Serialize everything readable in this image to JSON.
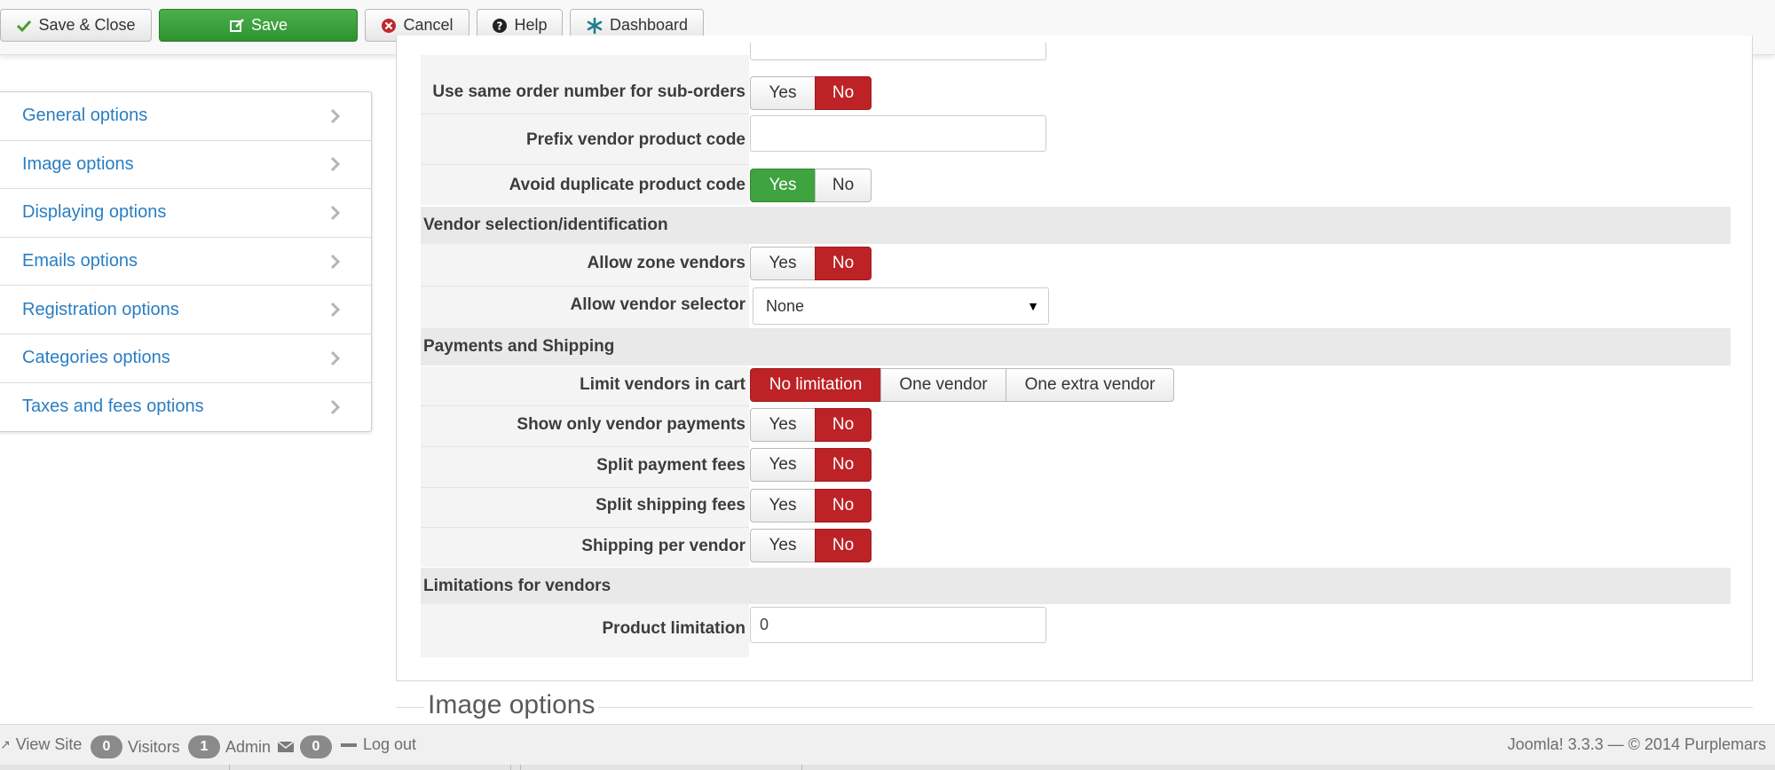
{
  "toolbar": {
    "save_close": "Save & Close",
    "save": "Save",
    "cancel": "Cancel",
    "help": "Help",
    "dashboard": "Dashboard"
  },
  "sidebar": {
    "items": [
      {
        "label": "General options"
      },
      {
        "label": "Image options"
      },
      {
        "label": "Displaying options"
      },
      {
        "label": "Emails options"
      },
      {
        "label": "Registration options"
      },
      {
        "label": "Categories options"
      },
      {
        "label": "Taxes and fees options"
      }
    ]
  },
  "form": {
    "same_order_number": {
      "label": "Use same order number for sub-orders",
      "yes": "Yes",
      "no": "No",
      "value": "No"
    },
    "prefix_code": {
      "label": "Prefix vendor product code",
      "value": ""
    },
    "avoid_duplicate": {
      "label": "Avoid duplicate product code",
      "yes": "Yes",
      "no": "No",
      "value": "Yes"
    },
    "section_vendor_selection": "Vendor selection/identification",
    "allow_zone_vendors": {
      "label": "Allow zone vendors",
      "yes": "Yes",
      "no": "No",
      "value": "No"
    },
    "allow_vendor_selector": {
      "label": "Allow vendor selector",
      "value": "None"
    },
    "section_payments": "Payments and Shipping",
    "limit_vendors_cart": {
      "label": "Limit vendors in cart",
      "options": [
        "No limitation",
        "One vendor",
        "One extra vendor"
      ],
      "value": "No limitation"
    },
    "show_vendor_payments": {
      "label": "Show only vendor payments",
      "yes": "Yes",
      "no": "No",
      "value": "No"
    },
    "split_payment_fees": {
      "label": "Split payment fees",
      "yes": "Yes",
      "no": "No",
      "value": "No"
    },
    "split_shipping_fees": {
      "label": "Split shipping fees",
      "yes": "Yes",
      "no": "No",
      "value": "No"
    },
    "shipping_per_vendor": {
      "label": "Shipping per vendor",
      "yes": "Yes",
      "no": "No",
      "value": "No"
    },
    "section_limitations": "Limitations for vendors",
    "product_limitation": {
      "label": "Product limitation",
      "value": "0"
    },
    "next_fieldset_title": "Image options"
  },
  "statusbar": {
    "view_site": "View Site",
    "visitors_count": "0",
    "visitors_label": "Visitors",
    "admin_count": "1",
    "admin_label": "Admin",
    "messages_count": "0",
    "logout": "Log out",
    "version": "Joomla! 3.3.3 — © 2014 Purplemars"
  },
  "colors": {
    "toggle_no_active": "#bd2226",
    "toggle_yes_active": "#3fa33f",
    "link": "#2a7ec2",
    "save_button": "#3a9d3a"
  }
}
